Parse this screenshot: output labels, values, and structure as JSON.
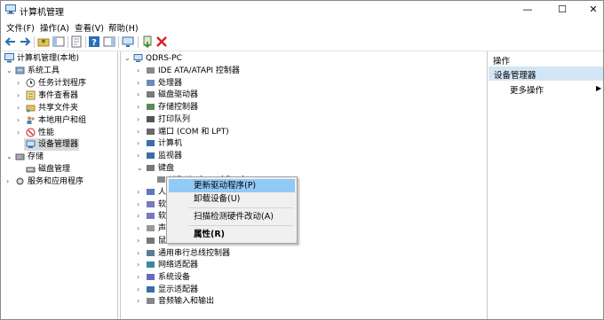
{
  "window": {
    "title": "计算机管理",
    "minimize": "—",
    "maximize": "☐",
    "close": "✕"
  },
  "menu": [
    "文件(F)",
    "操作(A)",
    "查看(V)",
    "帮助(H)"
  ],
  "left_tree": {
    "root": "计算机管理(本地)",
    "system_tools": "系统工具",
    "task_scheduler": "任务计划程序",
    "event_viewer": "事件查看器",
    "shared_folders": "共享文件夹",
    "local_users": "本地用户和组",
    "performance": "性能",
    "device_manager": "设备管理器",
    "storage": "存储",
    "disk_management": "磁盘管理",
    "services_apps": "服务和应用程序"
  },
  "device_tree": {
    "pc": "QDRS-PC",
    "items": [
      "IDE ATA/ATAPI 控制器",
      "处理器",
      "磁盘驱动器",
      "存储控制器",
      "打印队列",
      "端口 (COM 和 LPT)",
      "计算机",
      "监视器",
      "键盘",
      "HID Keyboard Device",
      "人机接口设备",
      "软件组件",
      "软件设备",
      "声音、视频和游戏控制器",
      "鼠标和其他指针设备",
      "通用串行总线控制器",
      "网络适配器",
      "系统设备",
      "显示适配器",
      "音频输入和输出"
    ]
  },
  "actions": {
    "header": "操作",
    "selected": "设备管理器",
    "more": "更多操作"
  },
  "context_menu": {
    "update": "更新驱动程序(P)",
    "uninstall": "卸载设备(U)",
    "scan": "扫描检测硬件改动(A)",
    "properties": "属性(R)"
  }
}
